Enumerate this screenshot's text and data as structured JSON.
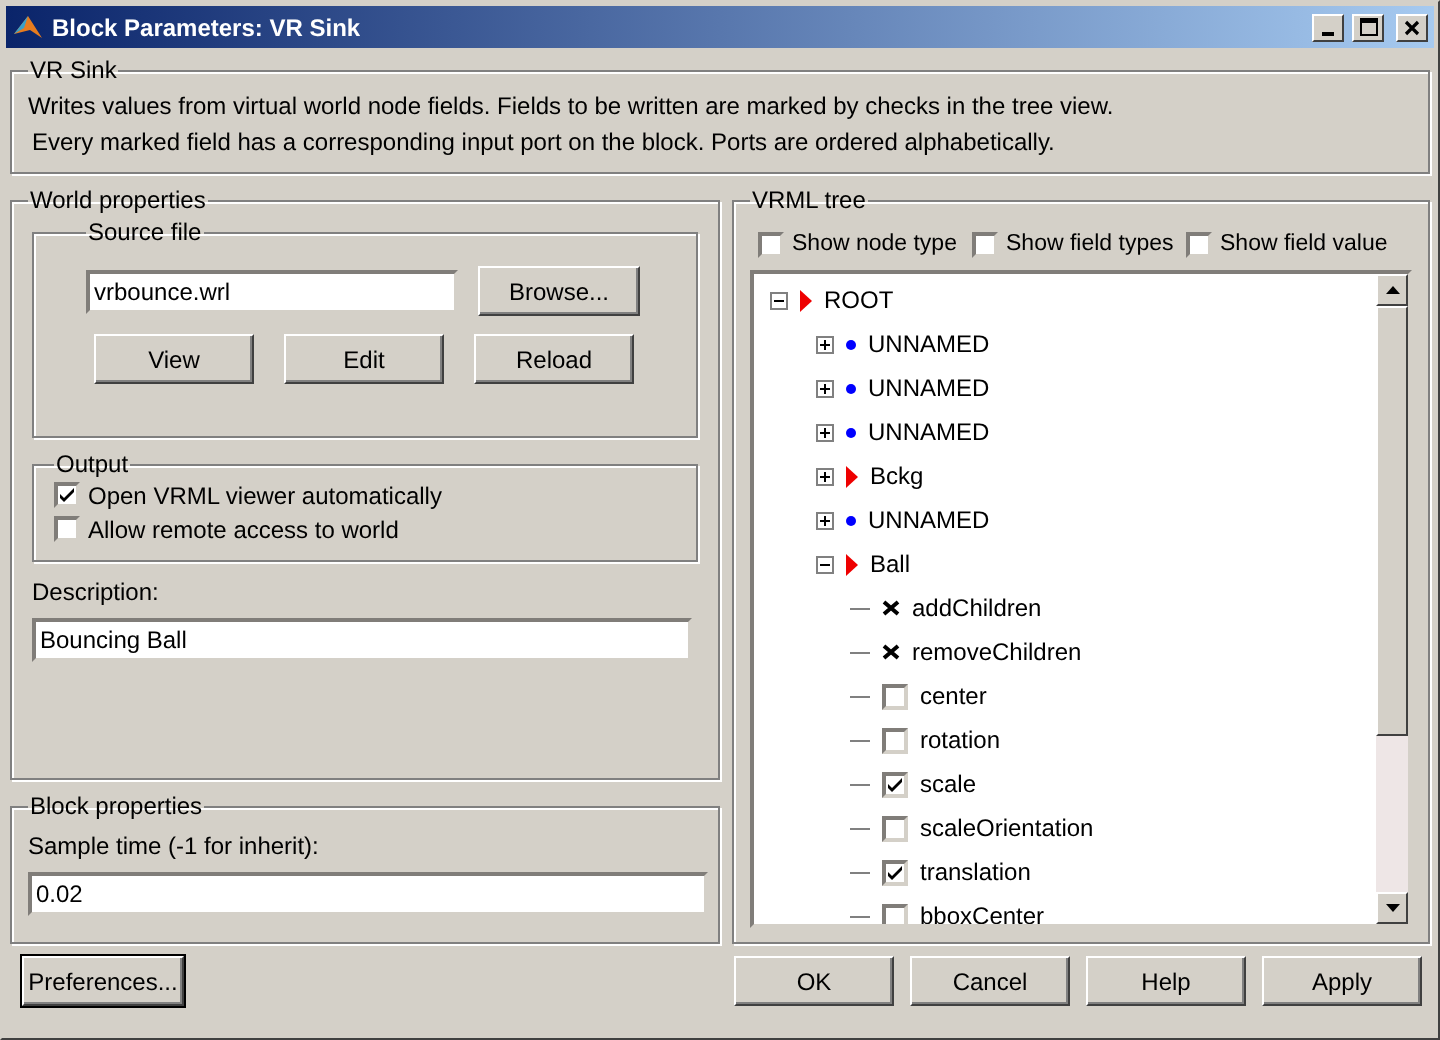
{
  "window": {
    "title": "Block Parameters: VR Sink"
  },
  "description_group": {
    "title": "VR Sink",
    "lines": [
      "Writes values from virtual world node fields. Fields to be written are marked by checks in the tree view.",
      "Every marked field has a corresponding input port on the block. Ports are ordered alphabetically."
    ]
  },
  "world_properties": {
    "title": "World properties",
    "source_file": {
      "title": "Source file",
      "value": "vrbounce.wrl",
      "browse": "Browse...",
      "buttons": [
        "View",
        "Edit",
        "Reload"
      ]
    },
    "output": {
      "title": "Output",
      "options": [
        {
          "label": "Open VRML viewer automatically",
          "checked": true
        },
        {
          "label": "Allow remote access to world",
          "checked": false
        }
      ]
    },
    "description": {
      "label": "Description:",
      "value": "Bouncing Ball"
    }
  },
  "block_properties": {
    "title": "Block properties",
    "label": "Sample time (-1 for inherit):",
    "value": "0.02"
  },
  "vrml_tree": {
    "title": "VRML tree",
    "options": [
      {
        "label": "Show node type",
        "checked": false
      },
      {
        "label": "Show field types",
        "checked": false
      },
      {
        "label": "Show field value",
        "checked": false
      }
    ],
    "nodes": [
      {
        "label": "ROOT",
        "kind": "node",
        "expanded": true,
        "children": [
          {
            "label": "UNNAMED",
            "kind": "group",
            "expanded": false
          },
          {
            "label": "UNNAMED",
            "kind": "group",
            "expanded": false
          },
          {
            "label": "UNNAMED",
            "kind": "group",
            "expanded": false
          },
          {
            "label": "Bckg",
            "kind": "node",
            "expanded": false
          },
          {
            "label": "UNNAMED",
            "kind": "group",
            "expanded": false
          },
          {
            "label": "Ball",
            "kind": "node",
            "expanded": true,
            "children": [
              {
                "label": "addChildren",
                "kind": "event"
              },
              {
                "label": "removeChildren",
                "kind": "event"
              },
              {
                "label": "center",
                "kind": "field",
                "checked": false
              },
              {
                "label": "rotation",
                "kind": "field",
                "checked": false
              },
              {
                "label": "scale",
                "kind": "field",
                "checked": true
              },
              {
                "label": "scaleOrientation",
                "kind": "field",
                "checked": false
              },
              {
                "label": "translation",
                "kind": "field",
                "checked": true
              },
              {
                "label": "bboxCenter",
                "kind": "field",
                "checked": false
              }
            ]
          }
        ]
      }
    ]
  },
  "buttons": {
    "preferences": "Preferences...",
    "actions": [
      "OK",
      "Cancel",
      "Help",
      "Apply"
    ]
  }
}
